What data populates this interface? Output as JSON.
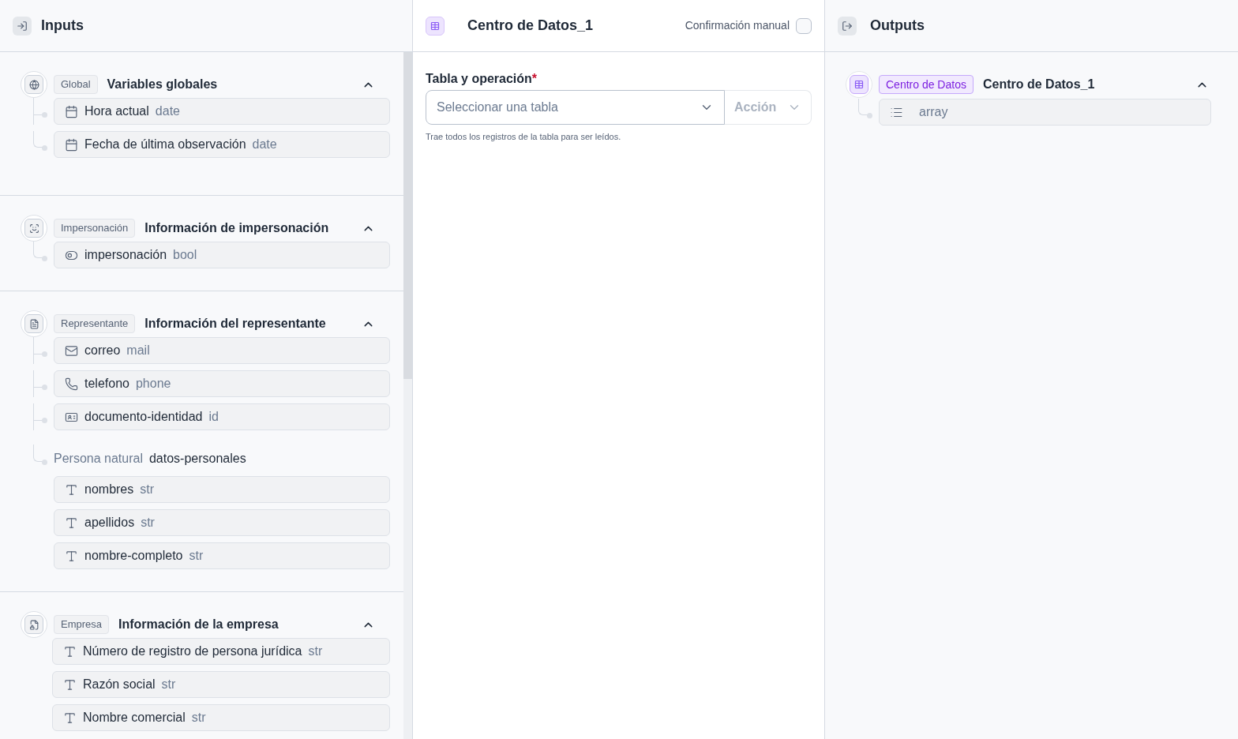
{
  "inputs": {
    "title": "Inputs",
    "sections": [
      {
        "kind": "globe",
        "tag": "Global",
        "title": "Variables globales",
        "expanded": true,
        "connectors": true,
        "items": [
          {
            "kind": "calendar",
            "label": "Hora actual",
            "type": "date"
          },
          {
            "kind": "calendar",
            "label": "Fecha de última observación",
            "type": "date"
          }
        ]
      },
      {
        "kind": "scan",
        "tag": "Impersonación",
        "title": "Información de impersonación",
        "expanded": true,
        "connectors": true,
        "items": [
          {
            "kind": "toggle",
            "label": "impersonación",
            "type": "bool"
          }
        ]
      },
      {
        "kind": "file",
        "tag": "Representante",
        "title": "Información del representante",
        "expanded": true,
        "connectors": true,
        "items": [
          {
            "kind": "mail",
            "label": "correo",
            "type": "mail"
          },
          {
            "kind": "phone",
            "label": "telefono",
            "type": "phone"
          },
          {
            "kind": "card",
            "label": "documento-identidad",
            "type": "id"
          },
          {
            "kind": "group",
            "label": "Persona natural",
            "type": "datos-personales",
            "children": [
              {
                "kind": "text",
                "label": "nombres",
                "type": "str"
              },
              {
                "kind": "text",
                "label": "apellidos",
                "type": "str"
              },
              {
                "kind": "text",
                "label": "nombre-completo",
                "type": "str"
              }
            ]
          }
        ]
      },
      {
        "kind": "filelock",
        "tag": "Empresa",
        "title": "Información de la empresa",
        "expanded": true,
        "connectors": false,
        "items": [
          {
            "kind": "text",
            "label": "Número de registro de persona jurídica",
            "type": "str"
          },
          {
            "kind": "text",
            "label": "Razón social",
            "type": "str"
          },
          {
            "kind": "text",
            "label": "Nombre comercial",
            "type": "str"
          }
        ]
      }
    ]
  },
  "editor": {
    "title": "Centro de Datos_1",
    "manual_confirmation": {
      "label": "Confirmación manual",
      "checked": false
    },
    "field": {
      "label": "Tabla y operación",
      "required_mark": "*",
      "placeholder": "Seleccionar una tabla",
      "action": {
        "label": "Acción",
        "disabled": true
      },
      "hint": "Trae todos los registros de la tabla para ser leídos."
    }
  },
  "outputs": {
    "title": "Outputs",
    "sections": [
      {
        "tag": "Centro de Datos",
        "title": "Centro de Datos_1",
        "expanded": true,
        "items": [
          {
            "kind": "list",
            "label": "array"
          }
        ]
      }
    ]
  }
}
